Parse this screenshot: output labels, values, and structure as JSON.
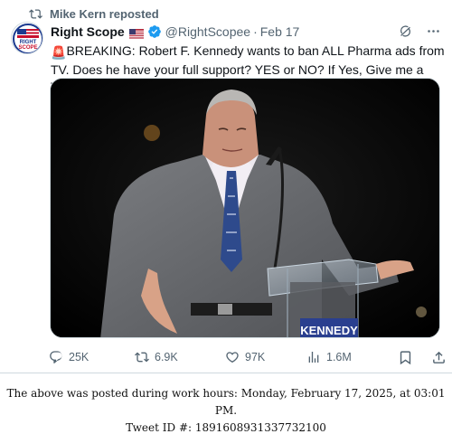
{
  "tweet": {
    "reposted_by": "Mike Kern reposted",
    "author_name": "Right Scope",
    "handle": "@RightScopee",
    "dot": "·",
    "date": "Feb 17",
    "avatar_text_top": "RIGHT",
    "avatar_text_bottom": "SCOPE",
    "text_main": "BREAKING: Robert F. Kennedy wants to ban ALL Pharma ads from TV. Does he have your full support? YES or NO? If Yes, Give me a THUMBS-UP",
    "text_end": "!",
    "alert_emoji": "🚨",
    "thumbs_emoji": "👍",
    "podium_sign": "KENNEDY"
  },
  "actions": {
    "replies": "25K",
    "reposts": "6.9K",
    "likes": "97K",
    "views": "1.6M"
  },
  "icons": [
    "repost-icon",
    "verified-icon",
    "flag-icon",
    "grok-icon",
    "more-icon",
    "reply-icon",
    "like-icon",
    "views-icon",
    "bookmark-icon",
    "share-icon"
  ],
  "colors": {
    "verified": "#1d9bf0",
    "muted": "#536471",
    "text": "#0f1419",
    "alert": "#e0245e"
  },
  "footer": {
    "line1": "The above was posted during work hours: Monday, February 17, 2025, at 03:01 PM.",
    "line2": "Tweet ID #: 1891608931337732100"
  }
}
